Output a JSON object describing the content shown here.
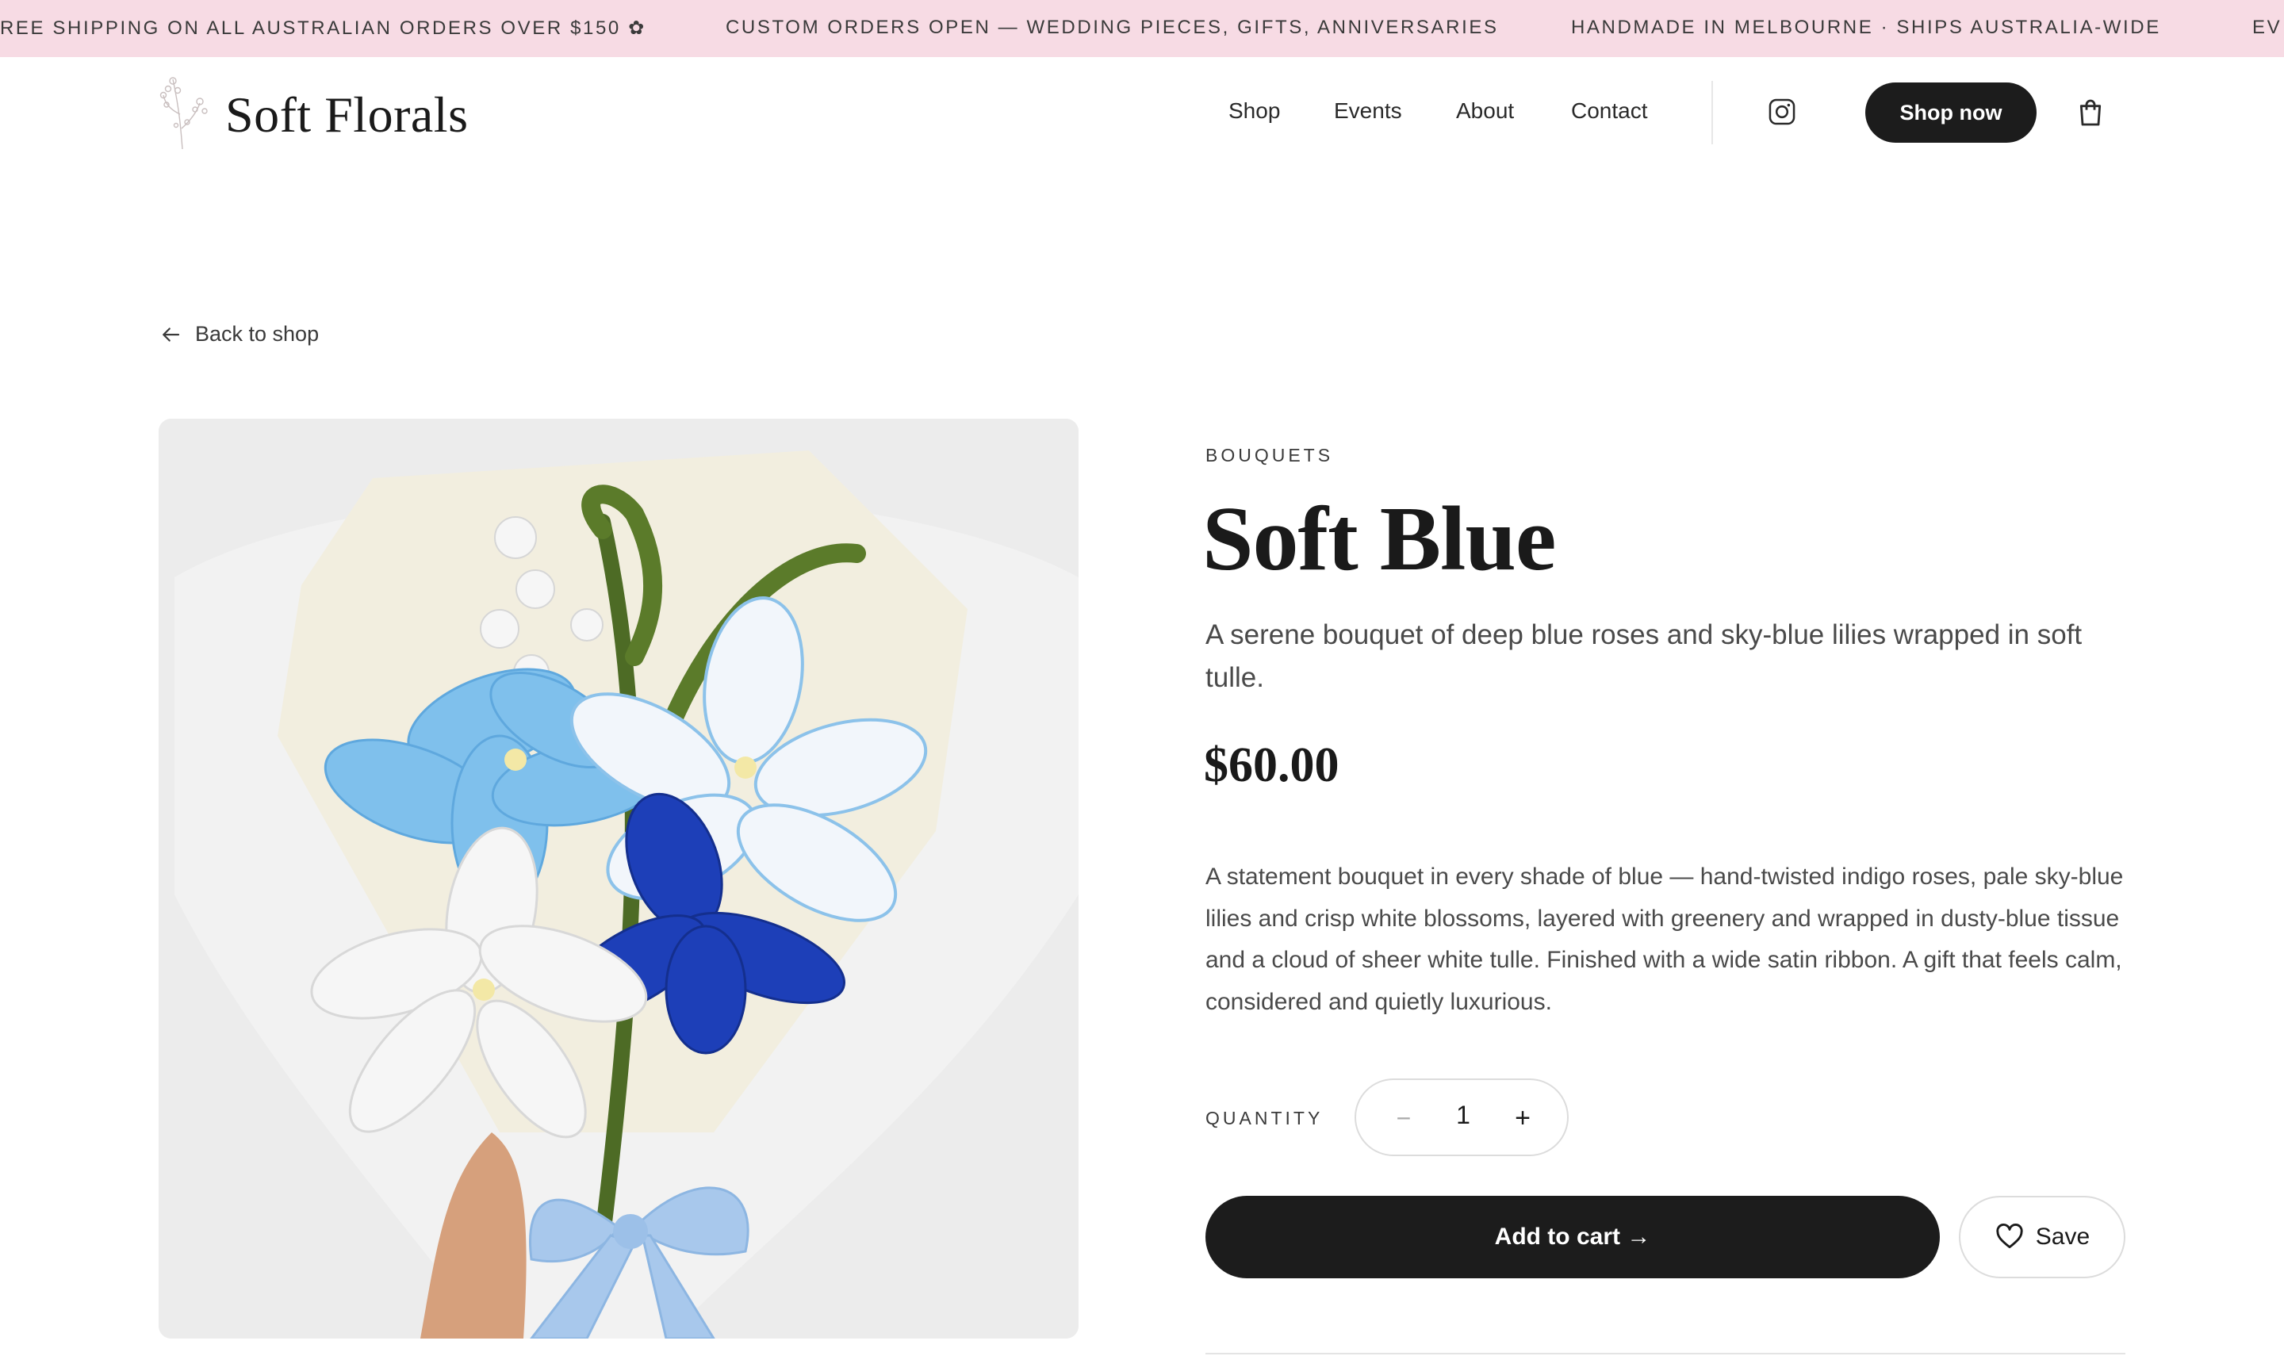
{
  "announcement": {
    "messages": [
      "REE SHIPPING ON ALL AUSTRALIAN ORDERS OVER $150 ✿",
      "CUSTOM ORDERS OPEN — WEDDING PIECES, GIFTS, ANNIVERSARIES",
      "HANDMADE IN MELBOURNE · SHIPS AUSTRALIA-WIDE",
      "EV"
    ],
    "background": "#f7dbe4"
  },
  "header": {
    "brand": "Soft Florals",
    "nav": [
      "Shop",
      "Events",
      "About",
      "Contact"
    ],
    "cta": "Shop now",
    "icons": [
      "instagram-icon",
      "cart-icon"
    ]
  },
  "back_link": "Back to shop",
  "product": {
    "category": "BOUQUETS",
    "title": "Soft Blue",
    "subtitle": "A serene bouquet of deep blue roses and sky-blue lilies wrapped in soft tulle.",
    "price": "$60.00",
    "description": "A statement bouquet in every shade of blue — hand-twisted indigo roses, pale sky-blue lilies and crisp white blossoms, layered with greenery and wrapped in dusty-blue tissue and a cloud of sheer white tulle. Finished with a wide satin ribbon. A gift that feels calm, considered and quietly luxurious.",
    "quantity_label": "QUANTITY",
    "quantity": "1",
    "add_to_cart": "Add to cart →",
    "save": "Save"
  },
  "colors": {
    "primary_button": "#1c1c1c",
    "text": "#1a1a1a",
    "muted": "#4a4a4a"
  }
}
